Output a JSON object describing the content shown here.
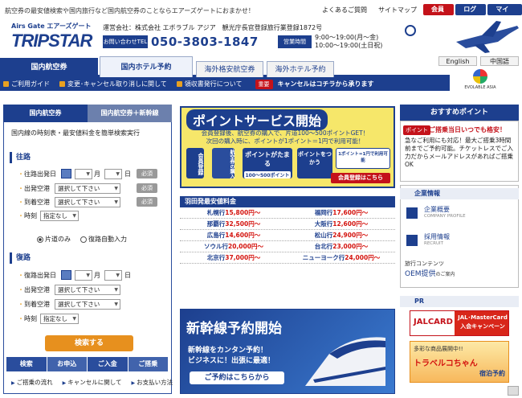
{
  "header": {
    "tagline": "航空券の最安値検索や国内旅行など国内航空券のことならエアーズゲートにおまかせ！",
    "faq": "よくあるご質問",
    "sitemap": "サイトマップ",
    "register": "会員登録",
    "login": "ログイン",
    "mypage": "マイページ",
    "logo_small": "Airs Gate エアーズゲート",
    "logo_main": "TRIPSTAR",
    "company": "運営会社：株式会社 エボラブル アジア　観光庁長官登録旅行業登録1872号",
    "tel_label": "お問い合わせTEL",
    "tel": "050-3803-1847",
    "hours_label": "営業時間",
    "hours_weekday": "9:00～19:00(月～金)",
    "hours_sat": "10:00～19:00(土日祝)",
    "english": "English",
    "chinese": "中国語",
    "evolable": "EVOLABLE ASIA"
  },
  "tabs": {
    "domestic_flight": "国内航空券",
    "domestic_hotel": "国内ホテル予約",
    "intl_flight": "海外格安航空券",
    "intl_hotel": "海外ホテル予約"
  },
  "guide": {
    "usage": "ご利用ガイド",
    "change": "変更･キャンセル取り消しに関して",
    "receipt": "領収書発行について",
    "important": "重要",
    "cancel": "キャンセルはコチラから承ります"
  },
  "search": {
    "tab_a": "国内航空券",
    "tab_b": "国内航空券＋新幹線",
    "desc": "国内線の時刻表・最安値料金を簡単検索実行",
    "outbound": "往路",
    "return": "復路",
    "date_label": "往路出発日",
    "ret_date_label": "復路出発日",
    "month": "月",
    "day": "日",
    "required": "必須",
    "dep_airport": "出発空港",
    "arr_airport": "到着空港",
    "time": "時刻",
    "select_placeholder": "選択して下さい",
    "time_placeholder": "指定なし",
    "oneway": "片道のみ",
    "auto_return": "復路自動入力",
    "search_button": "検索する",
    "steps": [
      "検索",
      "お申込",
      "ご入金",
      "ご搭乗"
    ],
    "links": [
      "ご搭乗の流れ",
      "キャンセルに関して",
      "お支払い方法"
    ]
  },
  "points": {
    "title": "ポイントサービス開始",
    "text1": "会員登録後、航空券の購入で、片道100～500ポイントGET！",
    "text2": "次回の購入時に、ポイントが1ポイント＝1円で利用可能！",
    "box1": "会員登録",
    "box2": "航空券の購入",
    "box3": "ポイントがたまる",
    "box3_sub": "100～500ポイント",
    "box4": "ポイントをつかう",
    "box4_sub": "1ポイント=1円で利用可能",
    "cta": "会員登録はこちら"
  },
  "fares": {
    "title": "羽田発最安値料金",
    "rows": [
      [
        {
          "dest": "札幌行",
          "price": "15,800円～"
        },
        {
          "dest": "福岡行",
          "price": "17,600円～"
        }
      ],
      [
        {
          "dest": "那覇行",
          "price": "32,500円～"
        },
        {
          "dest": "大阪行",
          "price": "12,600円～"
        }
      ],
      [
        {
          "dest": "広島行",
          "price": "14,600円～"
        },
        {
          "dest": "松山行",
          "price": "24,900円～"
        }
      ],
      [
        {
          "dest": "ソウル行",
          "price": "20,000円～"
        },
        {
          "dest": "台北行",
          "price": "23,000円～"
        }
      ],
      [
        {
          "dest": "北京行",
          "price": "37,000円～"
        },
        {
          "dest": "ニューヨーク行",
          "price": "24,000円～"
        }
      ]
    ]
  },
  "shinkansen": {
    "title": "新幹線予約開始",
    "line1": "新幹線をカンタン予約！",
    "line2": "ビジネスに！出張に最適！",
    "cta": "ご予約はこちらから"
  },
  "right": {
    "recommend_title": "おすすめポイント",
    "rec_badge": "ポイント",
    "rec_head": "ご搭乗当日いつでも格安！",
    "rec_body": "急なご利用にも対応！最大ご搭乗3時間前までご予約可能。チケットレスでご入力だからメールアドレスがあればご搭乗OK",
    "company_info": "企業情報",
    "profile": "企業概要",
    "profile_en": "COMPANY PROFILE",
    "recruit": "採用情報",
    "recruit_en": "RECRUIT",
    "oem_small": "旅行コンテンツ",
    "oem": "OEM提供",
    "oem_tail": "のご案内",
    "pr": "PR",
    "jal_logo": "JALCARD",
    "jal_text": "JAL･MasterCard 入会キャンペーン",
    "trv_small": "多彩な商品展開中!!",
    "trv_main": "トラベルコちゃん",
    "trv_tail": "宿泊予約"
  }
}
